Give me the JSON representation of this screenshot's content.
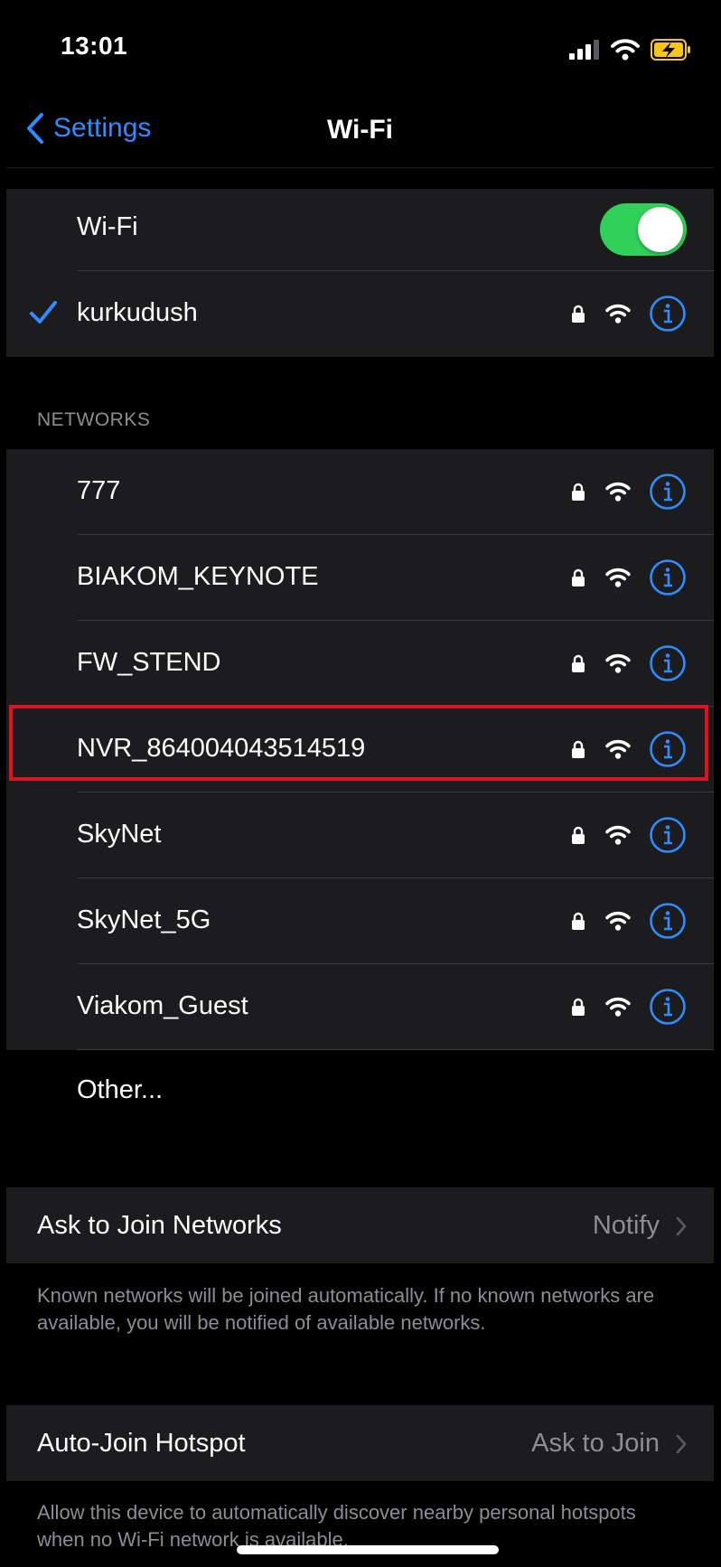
{
  "status_bar": {
    "time": "13:01"
  },
  "nav": {
    "back_label": "Settings",
    "title": "Wi-Fi"
  },
  "wifi_toggle": {
    "label": "Wi-Fi",
    "on": true
  },
  "connected": {
    "name": "kurkudush"
  },
  "networks_header": "NETWORKS",
  "networks": [
    {
      "name": "777"
    },
    {
      "name": "BIAKOM_KEYNOTE"
    },
    {
      "name": "FW_STEND"
    },
    {
      "name": "NVR_864004043514519"
    },
    {
      "name": "SkyNet"
    },
    {
      "name": "SkyNet_5G"
    },
    {
      "name": "Viakom_Guest"
    }
  ],
  "other_label": "Other...",
  "ask_to_join": {
    "label": "Ask to Join Networks",
    "value": "Notify",
    "footer": "Known networks will be joined automatically. If no known networks are available, you will be notified of available networks."
  },
  "auto_join": {
    "label": "Auto-Join Hotspot",
    "value": "Ask to Join",
    "footer": "Allow this device to automatically discover nearby personal hotspots when no Wi-Fi network is available."
  },
  "colors": {
    "accent": "#2f8cff",
    "toggle_on": "#30d158",
    "highlight": "#e3101d",
    "battery": "#f5c518"
  }
}
